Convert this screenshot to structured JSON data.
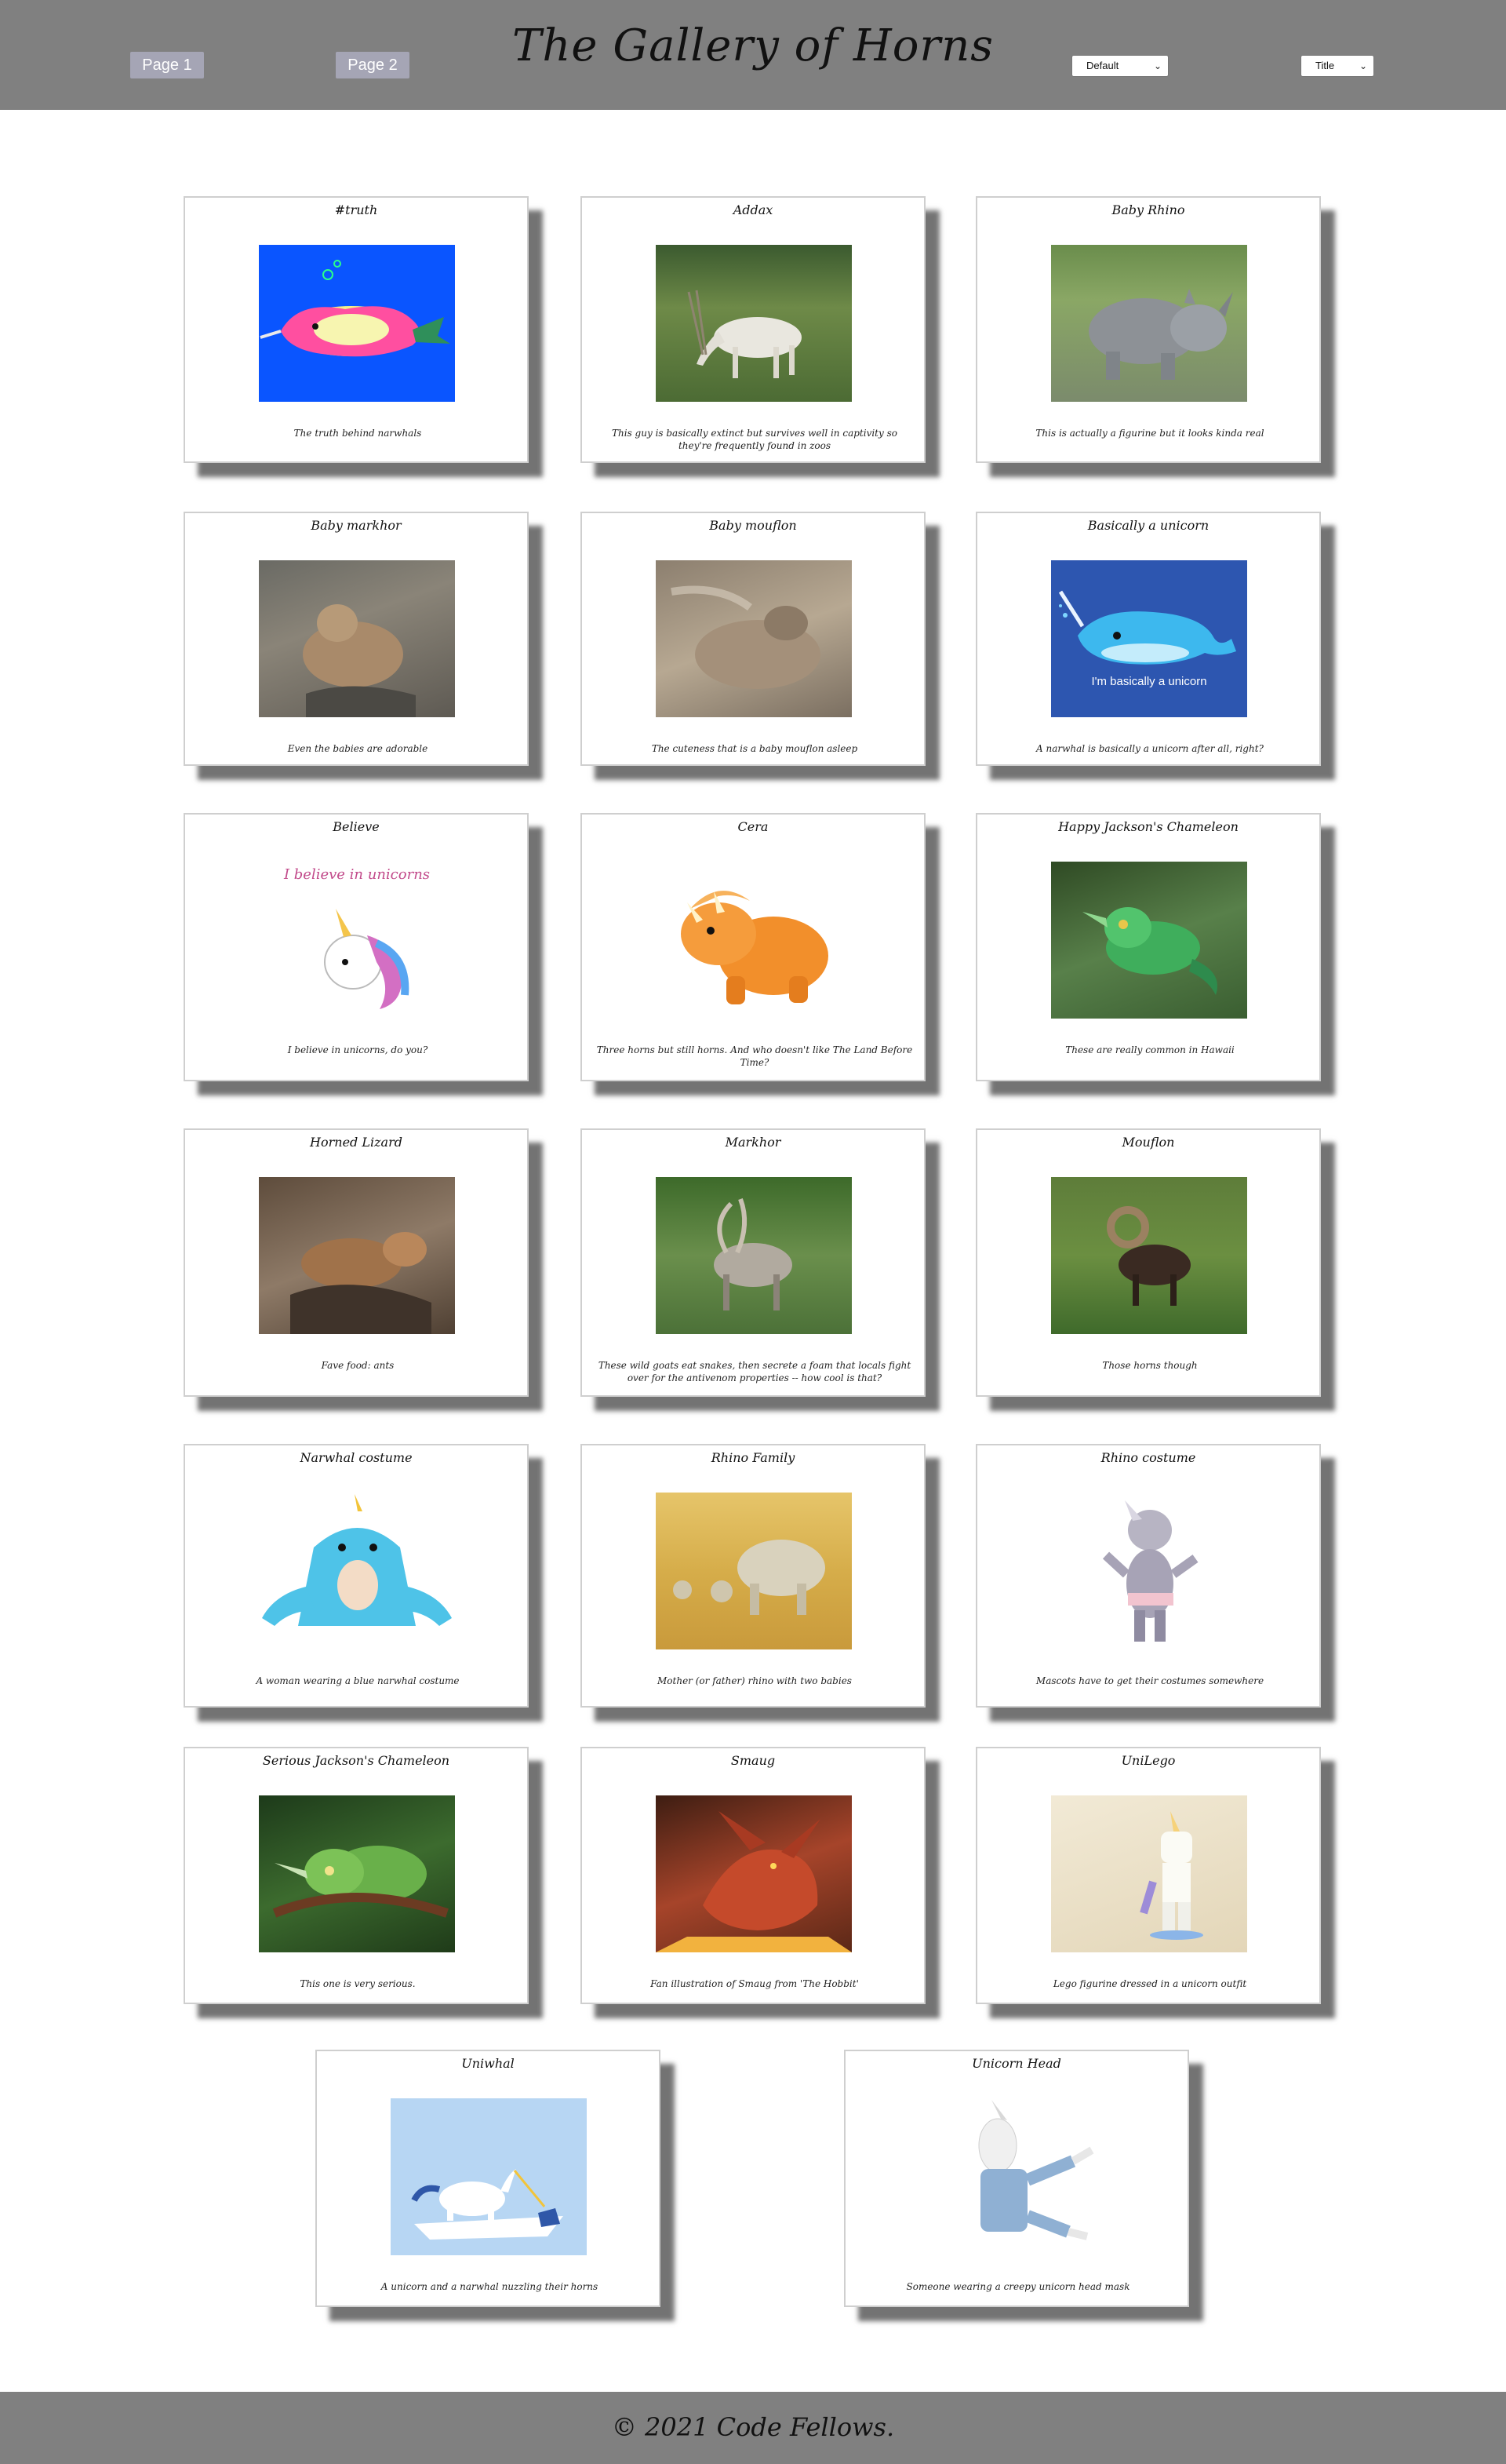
{
  "header": {
    "page1": "Page 1",
    "page2": "Page 2",
    "title": "The Gallery of Horns",
    "sort_default": "Default",
    "sort_title": "Title"
  },
  "cards": [
    {
      "title": "#truth",
      "description": "The truth behind narwhals",
      "image_icon": "narwhal-cartoon-icon"
    },
    {
      "title": "Addax",
      "description": "This guy is basically extinct but survives well in captivity so they're frequently found in zoos",
      "image_icon": "addax-photo"
    },
    {
      "title": "Baby Rhino",
      "description": "This is actually a figurine but it looks kinda real",
      "image_icon": "rhino-figurine-photo"
    },
    {
      "title": "Baby markhor",
      "description": "Even the babies are adorable",
      "image_icon": "baby-markhor-photo"
    },
    {
      "title": "Baby mouflon",
      "description": "The cuteness that is a baby mouflon asleep",
      "image_icon": "baby-mouflon-photo"
    },
    {
      "title": "Basically a unicorn",
      "description": "A narwhal is basically a unicorn after all, right?",
      "image_icon": "narwhal-illustration",
      "image_caption": "I'm basically a unicorn"
    },
    {
      "title": "Believe",
      "description": "I believe in unicorns, do you?",
      "image_icon": "unicorn-illustration",
      "image_caption": "I believe in unicorns"
    },
    {
      "title": "Cera",
      "description": "Three horns but still horns. And who doesn't like The Land Before Time?",
      "image_icon": "triceratops-cartoon"
    },
    {
      "title": "Happy Jackson's Chameleon",
      "description": "These are really common in Hawaii",
      "image_icon": "chameleon-photo"
    },
    {
      "title": "Horned Lizard",
      "description": "Fave food: ants",
      "image_icon": "horned-lizard-photo"
    },
    {
      "title": "Markhor",
      "description": "These wild goats eat snakes, then secrete a foam that locals fight over for the antivenom properties -- how cool is that?",
      "image_icon": "markhor-photo"
    },
    {
      "title": "Mouflon",
      "description": "Those horns though",
      "image_icon": "mouflon-photo"
    },
    {
      "title": "Narwhal costume",
      "description": "A woman wearing a blue narwhal costume",
      "image_icon": "narwhal-costume-photo"
    },
    {
      "title": "Rhino Family",
      "description": "Mother (or father) rhino with two babies",
      "image_icon": "rhino-family-photo"
    },
    {
      "title": "Rhino costume",
      "description": "Mascots have to get their costumes somewhere",
      "image_icon": "rhino-mascot-photo"
    },
    {
      "title": "Serious Jackson's Chameleon",
      "description": "This one is very serious.",
      "image_icon": "serious-chameleon-photo"
    },
    {
      "title": "Smaug",
      "description": "Fan illustration of Smaug from 'The Hobbit'",
      "image_icon": "smaug-illustration"
    },
    {
      "title": "UniLego",
      "description": "Lego figurine dressed in a unicorn outfit",
      "image_icon": "lego-unicorn-photo"
    },
    {
      "title": "Uniwhal",
      "description": "A unicorn and a narwhal nuzzling their horns",
      "image_icon": "unicorn-narwhal-illustration"
    },
    {
      "title": "Unicorn Head",
      "description": "Someone wearing a creepy unicorn head mask",
      "image_icon": "unicorn-mask-photo"
    }
  ],
  "footer": {
    "text": "© 2021 Code Fellows."
  }
}
